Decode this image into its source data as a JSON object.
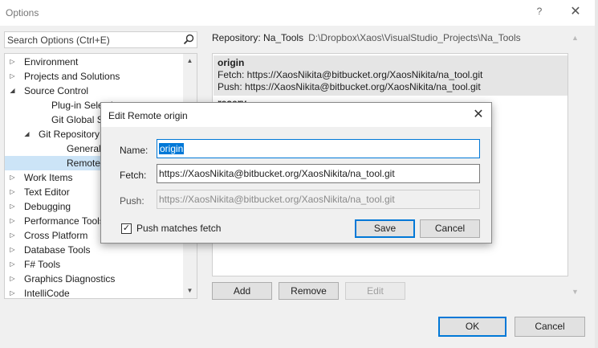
{
  "window": {
    "title": "Options",
    "help_glyph": "?",
    "close_glyph": "✕"
  },
  "search": {
    "placeholder": "Search Options (Ctrl+E)",
    "icon": "search-icon"
  },
  "tree": {
    "items": [
      {
        "label": "Environment",
        "expander": "▷"
      },
      {
        "label": "Projects and Solutions",
        "expander": "▷"
      },
      {
        "label": "Source Control",
        "expander": "◢"
      },
      {
        "label": "Plug-in Selecti"
      },
      {
        "label": "Git Global Setti"
      },
      {
        "label": "Git Repository",
        "expander": "◢"
      },
      {
        "label": "General"
      },
      {
        "label": "Remotes",
        "selected": true
      },
      {
        "label": "Work Items",
        "expander": "▷"
      },
      {
        "label": "Text Editor",
        "expander": "▷"
      },
      {
        "label": "Debugging",
        "expander": "▷"
      },
      {
        "label": "Performance Tools",
        "expander": "▷"
      },
      {
        "label": "Cross Platform",
        "expander": "▷"
      },
      {
        "label": "Database Tools",
        "expander": "▷"
      },
      {
        "label": "F# Tools",
        "expander": "▷"
      },
      {
        "label": "Graphics Diagnostics",
        "expander": "▷"
      },
      {
        "label": "IntelliCode",
        "expander": "▷"
      }
    ],
    "scroll_up": "▲",
    "scroll_down": "▼"
  },
  "repository": {
    "label": "Repository: Na_Tools",
    "path": "D:\\Dropbox\\Xaos\\VisualStudio_Projects\\Na_Tools"
  },
  "remotes": [
    {
      "name": "origin",
      "fetch": "Fetch: https://XaosNikita@bitbucket.org/XaosNikita/na_tool.git",
      "push": "Push: https://XaosNikita@bitbucket.org/XaosNikita/na_tool.git"
    },
    {
      "name": "resery"
    }
  ],
  "remote_buttons": {
    "add": "Add",
    "remove": "Remove",
    "edit": "Edit"
  },
  "footer": {
    "ok": "OK",
    "cancel": "Cancel"
  },
  "dialog": {
    "title": "Edit Remote origin",
    "close_glyph": "✕",
    "name_label": "Name:",
    "name_value": "origin",
    "fetch_label": "Fetch:",
    "fetch_value": "https://XaosNikita@bitbucket.org/XaosNikita/na_tool.git",
    "push_label": "Push:",
    "push_value": "https://XaosNikita@bitbucket.org/XaosNikita/na_tool.git",
    "push_matches_fetch_label": "Push matches fetch",
    "push_matches_fetch_checked": true,
    "check_glyph": "✓",
    "save": "Save",
    "cancel": "Cancel"
  },
  "colors": {
    "accent": "#0078d7",
    "selection": "#cce4f7"
  }
}
